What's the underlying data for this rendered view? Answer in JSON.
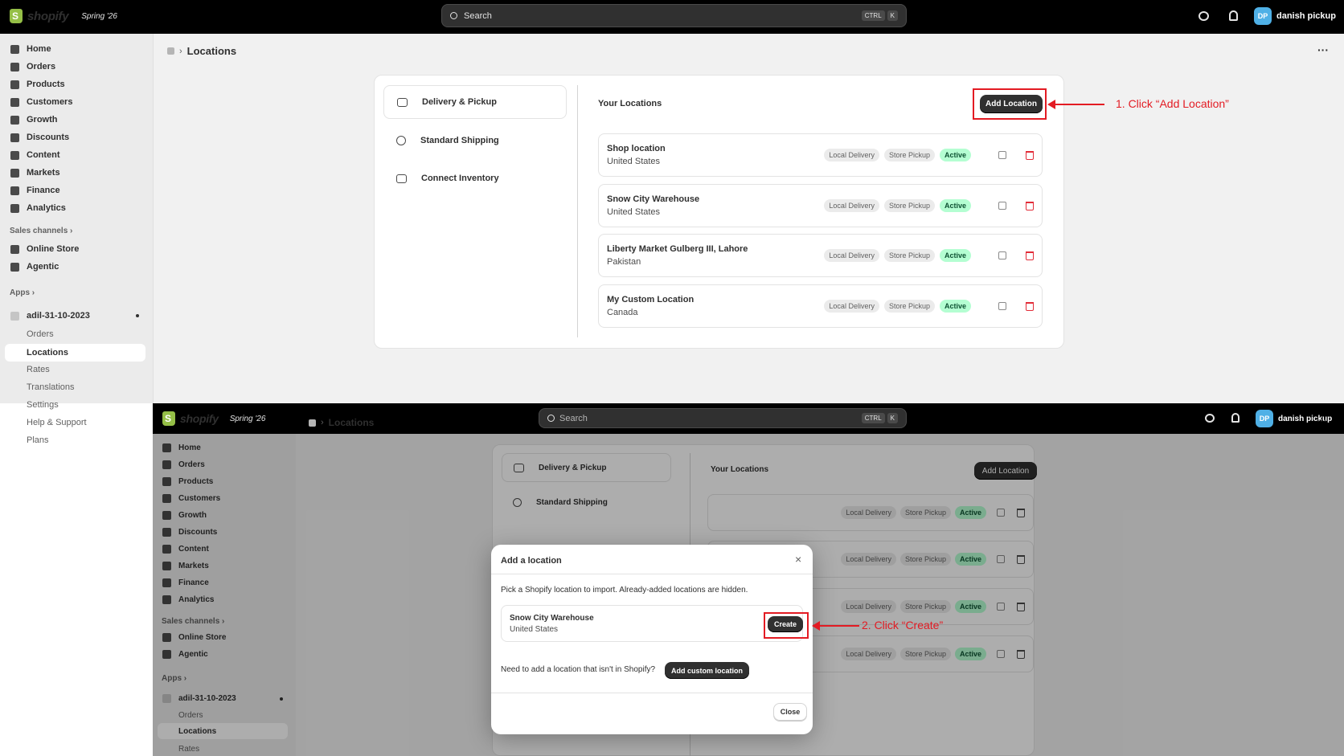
{
  "app": {
    "brand": "shopify",
    "version": "Spring '26"
  },
  "search": {
    "placeholder": "Search",
    "key1": "CTRL",
    "key2": "K"
  },
  "user": {
    "initials": "DP",
    "name": "danish pickup"
  },
  "nav": {
    "items": [
      "Home",
      "Orders",
      "Products",
      "Customers",
      "Growth",
      "Discounts",
      "Content",
      "Markets",
      "Finance",
      "Analytics"
    ],
    "sales_channels": "Sales channels",
    "channels": [
      "Online Store",
      "Agentic"
    ],
    "apps": "Apps",
    "app_name": "adil-31-10-2023",
    "app_sub": [
      "Orders",
      "Locations",
      "Rates",
      "Translations",
      "Settings",
      "Help & Support",
      "Plans"
    ]
  },
  "page": {
    "title": "Locations",
    "more": "···"
  },
  "tabs": [
    "Delivery & Pickup",
    "Standard Shipping",
    "Connect Inventory"
  ],
  "locations": {
    "heading": "Your Locations",
    "add_label": "Add Location",
    "list": [
      {
        "name": "Shop location",
        "country": "United States"
      },
      {
        "name": "Snow City Warehouse",
        "country": "United States"
      },
      {
        "name": "Liberty Market Gulberg III, Lahore",
        "country": "Pakistan"
      },
      {
        "name": "My Custom Location",
        "country": "Canada"
      }
    ],
    "badges": {
      "delivery": "Local Delivery",
      "pickup": "Store Pickup",
      "status": "Active"
    }
  },
  "callouts": {
    "step1": "1. Click “Add Location”",
    "step2": "2. Click “Create”"
  },
  "modal": {
    "title": "Add a location",
    "description": "Pick a Shopify location to import. Already-added locations are hidden.",
    "option": {
      "name": "Snow City Warehouse",
      "country": "United States"
    },
    "create_label": "Create",
    "custom_prompt": "Need to add a location that isn't in Shopify?",
    "custom_label": "Add custom location",
    "close_label": "Close"
  },
  "colors": {
    "accent_red": "#e31b23",
    "active_bg": "#b4fed2",
    "active_text": "#0c5132"
  }
}
